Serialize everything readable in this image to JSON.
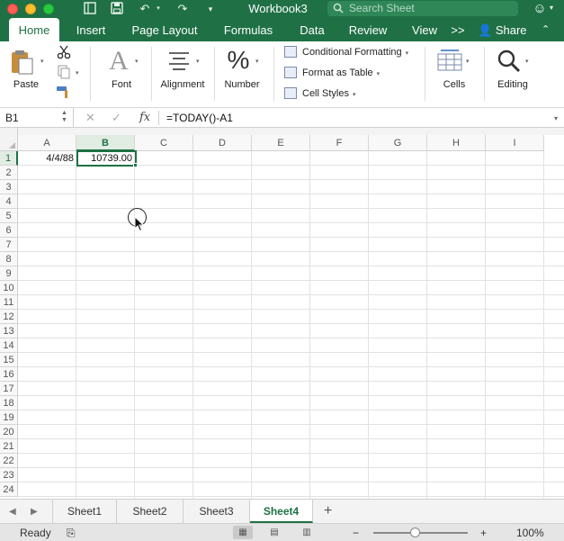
{
  "window": {
    "title": "Workbook3",
    "search_placeholder": "Search Sheet"
  },
  "ribbon_tabs": [
    {
      "label": "Home",
      "active": true
    },
    {
      "label": "Insert"
    },
    {
      "label": "Page Layout"
    },
    {
      "label": "Formulas"
    },
    {
      "label": "Data"
    },
    {
      "label": "Review"
    },
    {
      "label": "View"
    }
  ],
  "tabs_overflow": ">>",
  "share_label": "Share",
  "ribbon": {
    "paste_label": "Paste",
    "font_label": "Font",
    "alignment_label": "Alignment",
    "number_label": "Number",
    "conditional_formatting_label": "Conditional Formatting",
    "format_as_table_label": "Format as Table",
    "cell_styles_label": "Cell Styles",
    "cells_label": "Cells",
    "editing_label": "Editing"
  },
  "formula_bar": {
    "name_box": "B1",
    "fx": "fx",
    "formula": "=TODAY()-A1"
  },
  "columns": [
    "A",
    "B",
    "C",
    "D",
    "E",
    "F",
    "G",
    "H",
    "I"
  ],
  "rows": [
    "1",
    "2",
    "3",
    "4",
    "5",
    "6",
    "7",
    "8",
    "9",
    "10",
    "11",
    "12",
    "13",
    "14",
    "15",
    "16",
    "17",
    "18",
    "19",
    "20",
    "21",
    "22",
    "23",
    "24"
  ],
  "cells": {
    "A1": "4/4/88",
    "B1": "10739.00"
  },
  "selected_cell": "B1",
  "sheets": [
    {
      "label": "Sheet1"
    },
    {
      "label": "Sheet2"
    },
    {
      "label": "Sheet3"
    },
    {
      "label": "Sheet4",
      "active": true
    }
  ],
  "add_sheet": "+",
  "status": {
    "ready": "Ready",
    "zoom": "100%",
    "zoom_out": "−",
    "zoom_in": "+"
  },
  "colors": {
    "excel_green": "#1f7145",
    "title_bar": "#1f7145"
  }
}
